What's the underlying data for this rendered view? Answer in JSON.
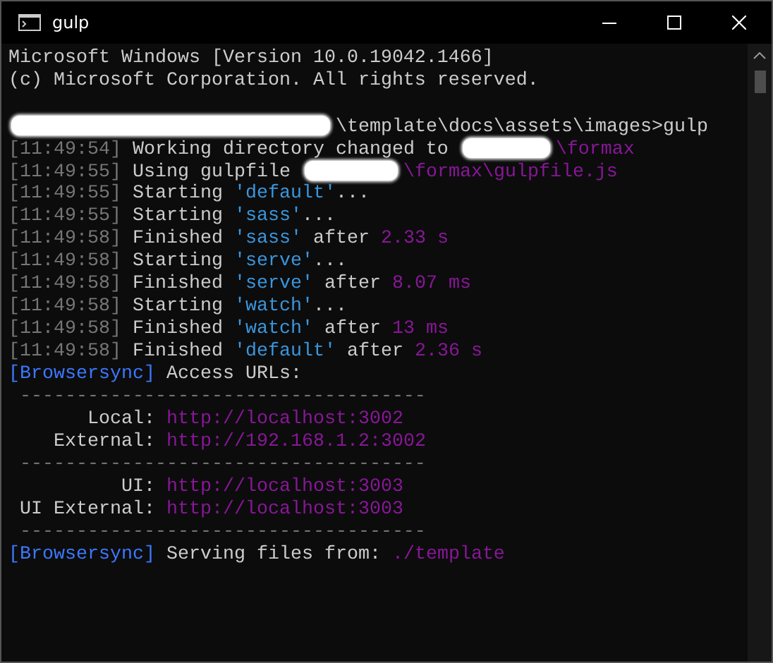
{
  "window": {
    "title": "gulp"
  },
  "console": {
    "lines": [
      [
        {
          "kind": "text",
          "text": "Microsoft Windows [Version 10.0.19042.1466]"
        }
      ],
      [
        {
          "kind": "text",
          "text": "(c) Microsoft Corporation. All rights reserved."
        }
      ],
      {
        "kind": "blank"
      },
      [
        {
          "kind": "blur_long"
        },
        {
          "kind": "text",
          "text": "\\template\\docs\\assets\\images>gulp"
        }
      ],
      [
        {
          "kind": "time",
          "text": "[11:49:54]"
        },
        {
          "kind": "text",
          "text": " Working directory changed to "
        },
        {
          "kind": "blur_medium"
        },
        {
          "kind": "value",
          "text": "\\formax"
        }
      ],
      [
        {
          "kind": "time",
          "text": "[11:49:55]"
        },
        {
          "kind": "text",
          "text": " Using gulpfile "
        },
        {
          "kind": "blur_short"
        },
        {
          "kind": "value",
          "text": "\\formax\\gulpfile.js"
        }
      ],
      [
        {
          "kind": "time",
          "text": "[11:49:55]"
        },
        {
          "kind": "text",
          "text": " Starting "
        },
        {
          "kind": "task",
          "text": "'default'"
        },
        {
          "kind": "text",
          "text": "..."
        }
      ],
      [
        {
          "kind": "time",
          "text": "[11:49:55]"
        },
        {
          "kind": "text",
          "text": " Starting "
        },
        {
          "kind": "task",
          "text": "'sass'"
        },
        {
          "kind": "text",
          "text": "..."
        }
      ],
      [
        {
          "kind": "time",
          "text": "[11:49:58]"
        },
        {
          "kind": "text",
          "text": " Finished "
        },
        {
          "kind": "task",
          "text": "'sass'"
        },
        {
          "kind": "text",
          "text": " after "
        },
        {
          "kind": "value",
          "text": "2.33 s"
        }
      ],
      [
        {
          "kind": "time",
          "text": "[11:49:58]"
        },
        {
          "kind": "text",
          "text": " Starting "
        },
        {
          "kind": "task",
          "text": "'serve'"
        },
        {
          "kind": "text",
          "text": "..."
        }
      ],
      [
        {
          "kind": "time",
          "text": "[11:49:58]"
        },
        {
          "kind": "text",
          "text": " Finished "
        },
        {
          "kind": "task",
          "text": "'serve'"
        },
        {
          "kind": "text",
          "text": " after "
        },
        {
          "kind": "value",
          "text": "8.07 ms"
        }
      ],
      [
        {
          "kind": "time",
          "text": "[11:49:58]"
        },
        {
          "kind": "text",
          "text": " Starting "
        },
        {
          "kind": "task",
          "text": "'watch'"
        },
        {
          "kind": "text",
          "text": "..."
        }
      ],
      [
        {
          "kind": "time",
          "text": "[11:49:58]"
        },
        {
          "kind": "text",
          "text": " Finished "
        },
        {
          "kind": "task",
          "text": "'watch'"
        },
        {
          "kind": "text",
          "text": " after "
        },
        {
          "kind": "value",
          "text": "13 ms"
        }
      ],
      [
        {
          "kind": "time",
          "text": "[11:49:58]"
        },
        {
          "kind": "text",
          "text": " Finished "
        },
        {
          "kind": "task",
          "text": "'default'"
        },
        {
          "kind": "text",
          "text": " after "
        },
        {
          "kind": "value",
          "text": "2.36 s"
        }
      ],
      [
        {
          "kind": "tag",
          "text": "[Browsersync]"
        },
        {
          "kind": "text",
          "text": " Access URLs:"
        }
      ],
      [
        {
          "kind": "dim",
          "text": " ------------------------------------"
        }
      ],
      [
        {
          "kind": "text",
          "text": "       Local: "
        },
        {
          "kind": "value",
          "text": "http://localhost:3002"
        }
      ],
      [
        {
          "kind": "text",
          "text": "    External: "
        },
        {
          "kind": "value",
          "text": "http://192.168.1.2:3002"
        }
      ],
      [
        {
          "kind": "dim",
          "text": " ------------------------------------"
        }
      ],
      [
        {
          "kind": "text",
          "text": "          UI: "
        },
        {
          "kind": "value",
          "text": "http://localhost:3003"
        }
      ],
      [
        {
          "kind": "text",
          "text": " UI External: "
        },
        {
          "kind": "value",
          "text": "http://localhost:3003"
        }
      ],
      [
        {
          "kind": "dim",
          "text": " ------------------------------------"
        }
      ],
      [
        {
          "kind": "tag",
          "text": "[Browsersync]"
        },
        {
          "kind": "text",
          "text": " Serving files from: "
        },
        {
          "kind": "value",
          "text": "./template"
        }
      ]
    ]
  }
}
